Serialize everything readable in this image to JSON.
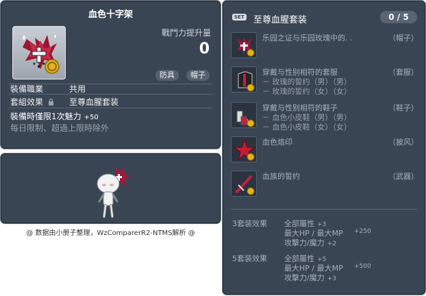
{
  "item_id": "01005037",
  "item": {
    "name": "血色十字架",
    "power_label": "戰鬥力提升量",
    "power_value": "0",
    "tags": [
      "防具",
      "帽子"
    ],
    "job_label": "裝備職業",
    "job_value": "共用",
    "set_label": "套組效果",
    "set_value": "至尊血腥套装",
    "limit_text": "裝備時僅限1次魅力",
    "limit_bonus": "+50",
    "limit_note": "每日限制、超過上限時除外"
  },
  "footer_note": "@ 数据由小册子整理，WzComparerR2-NTMS解析 @",
  "set": {
    "badge": "SET",
    "name": "至尊血腥套装",
    "count": "0 / 5",
    "parts": [
      {
        "name": "乐园之证与乐园玫瑰中的. .",
        "category": "（帽子）",
        "subs": [],
        "icon": "cross-icon"
      },
      {
        "name": "穿戴与性别相符的套服",
        "category": "（套服）",
        "subs": [
          "－ 玫瑰的誓约（男）（男）",
          "－ 玫瑰的誓约（女）（女）"
        ],
        "icon": "suit-icon"
      },
      {
        "name": "穿戴与性别相符的鞋子",
        "category": "（鞋子）",
        "subs": [
          "－ 血色小皮鞋（男）（男）",
          "－ 血色小皮鞋（女）（女）"
        ],
        "icon": "shoes-icon"
      },
      {
        "name": "血色烙印",
        "category": "（披风）",
        "subs": [],
        "icon": "star-icon"
      },
      {
        "name": "血族的誓约",
        "category": "（武器）",
        "subs": [],
        "icon": "sword-icon"
      }
    ],
    "bonuses": [
      {
        "label": "3套装效果",
        "lines": [
          {
            "stat": "全部屬性",
            "value": "+3"
          },
          {
            "stat": "最大HP / 最大MP",
            "value": "+250"
          },
          {
            "stat": "攻擊力/魔力",
            "value": "+2"
          }
        ]
      },
      {
        "label": "5套装效果",
        "lines": [
          {
            "stat": "全部屬性",
            "value": "+5"
          },
          {
            "stat": "最大HP / 最大MP",
            "value": "+500"
          },
          {
            "stat": "攻擊力/魔力",
            "value": "+3"
          }
        ]
      }
    ]
  }
}
